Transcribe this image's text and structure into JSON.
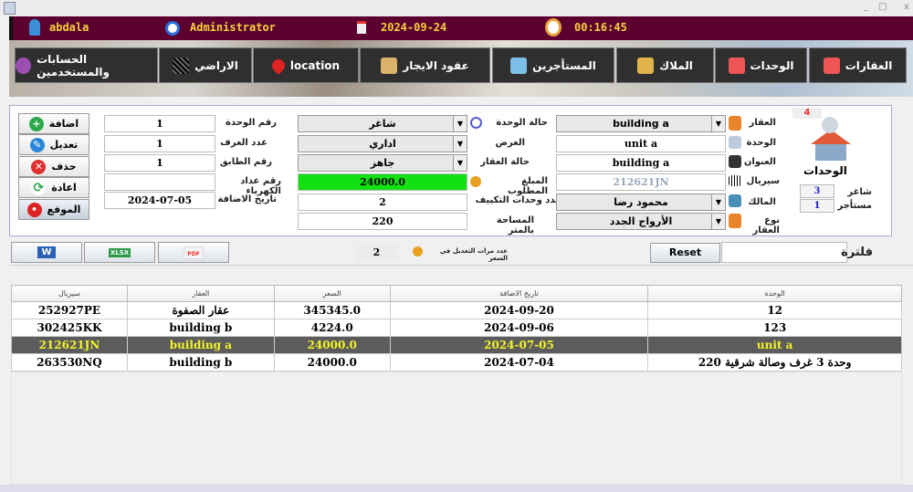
{
  "header": {
    "user": "abdala",
    "role": "Administrator",
    "date": "2024-09-24",
    "time": "00:16:45"
  },
  "nav": [
    "الحسابات والمستخدمين",
    "الاراضي",
    "location",
    "عقود الايجار",
    "المستأجرين",
    "الملاك",
    "الوحدات",
    "العقارات"
  ],
  "buttons": {
    "add": "اضافة",
    "edit": "تعديل",
    "delete": "حذف",
    "reset": "اعادة",
    "location": "الموقع"
  },
  "form": {
    "unit_number_label": "رقم الوحدة",
    "unit_number": "1",
    "rooms_label": "عدد الغرف",
    "rooms": "1",
    "floor_label": "رقم الطابق",
    "floor": "1",
    "meter_label": "رقم عداد الكهرباء",
    "meter": "",
    "added_date_label": "تاريخ الاضافة",
    "added_date": "2024-07-05",
    "unit_status_label": "حالة الوحدة",
    "unit_status": "شاغر",
    "purpose_label": "الغرض",
    "purpose": "اداري",
    "property_status_label": "حالة العقار",
    "property_status": "جاهز",
    "amount_label": "المبلغ المطلوب",
    "amount": "24000.0",
    "ac_units_label": "عدد وحدات التكييف",
    "ac_units": "2",
    "area_label": "المساحة بالمتر",
    "area": "220",
    "property_label": "العقار",
    "property": "building a",
    "unit_label": "الوحدة",
    "unit": "unit a",
    "address_label": "العنوان",
    "address": "building a",
    "serial_label": "سيريال",
    "serial": "212621JN",
    "owner_label": "المالك",
    "owner": "محمود رضا",
    "property_type_label": "نوع العقار",
    "property_type": "الأرواج الجدد"
  },
  "summary": {
    "count": "4",
    "title": "الوحدات",
    "vacant_label": "شاغر",
    "vacant": "3",
    "rented_label": "مستأجر",
    "rented": "1"
  },
  "export": {
    "word": "W",
    "xlsx": "XLSX",
    "pdf": "PDF"
  },
  "price_edits": {
    "count": "2",
    "label": "عدد مرات التعديل في السعر"
  },
  "filter": {
    "reset": "Reset",
    "value": "",
    "label": "فلترة"
  },
  "table": {
    "headers": [
      "سيريال",
      "العقار",
      "السعر",
      "تاريخ الاضافة",
      "الوحدة"
    ],
    "rows": [
      [
        "252927PE",
        "عقار الصفوة",
        "345345.0",
        "2024-09-20",
        "12"
      ],
      [
        "302425KK",
        "building b",
        "4224.0",
        "2024-09-06",
        "123"
      ],
      [
        "212621JN",
        "building a",
        "24000.0",
        "2024-07-05",
        "unit a"
      ],
      [
        "263530NQ",
        "building b",
        "24000.0",
        "2024-07-04",
        "وحدة 3 غرف وصالة شرقية 220"
      ]
    ],
    "selected": 2
  }
}
